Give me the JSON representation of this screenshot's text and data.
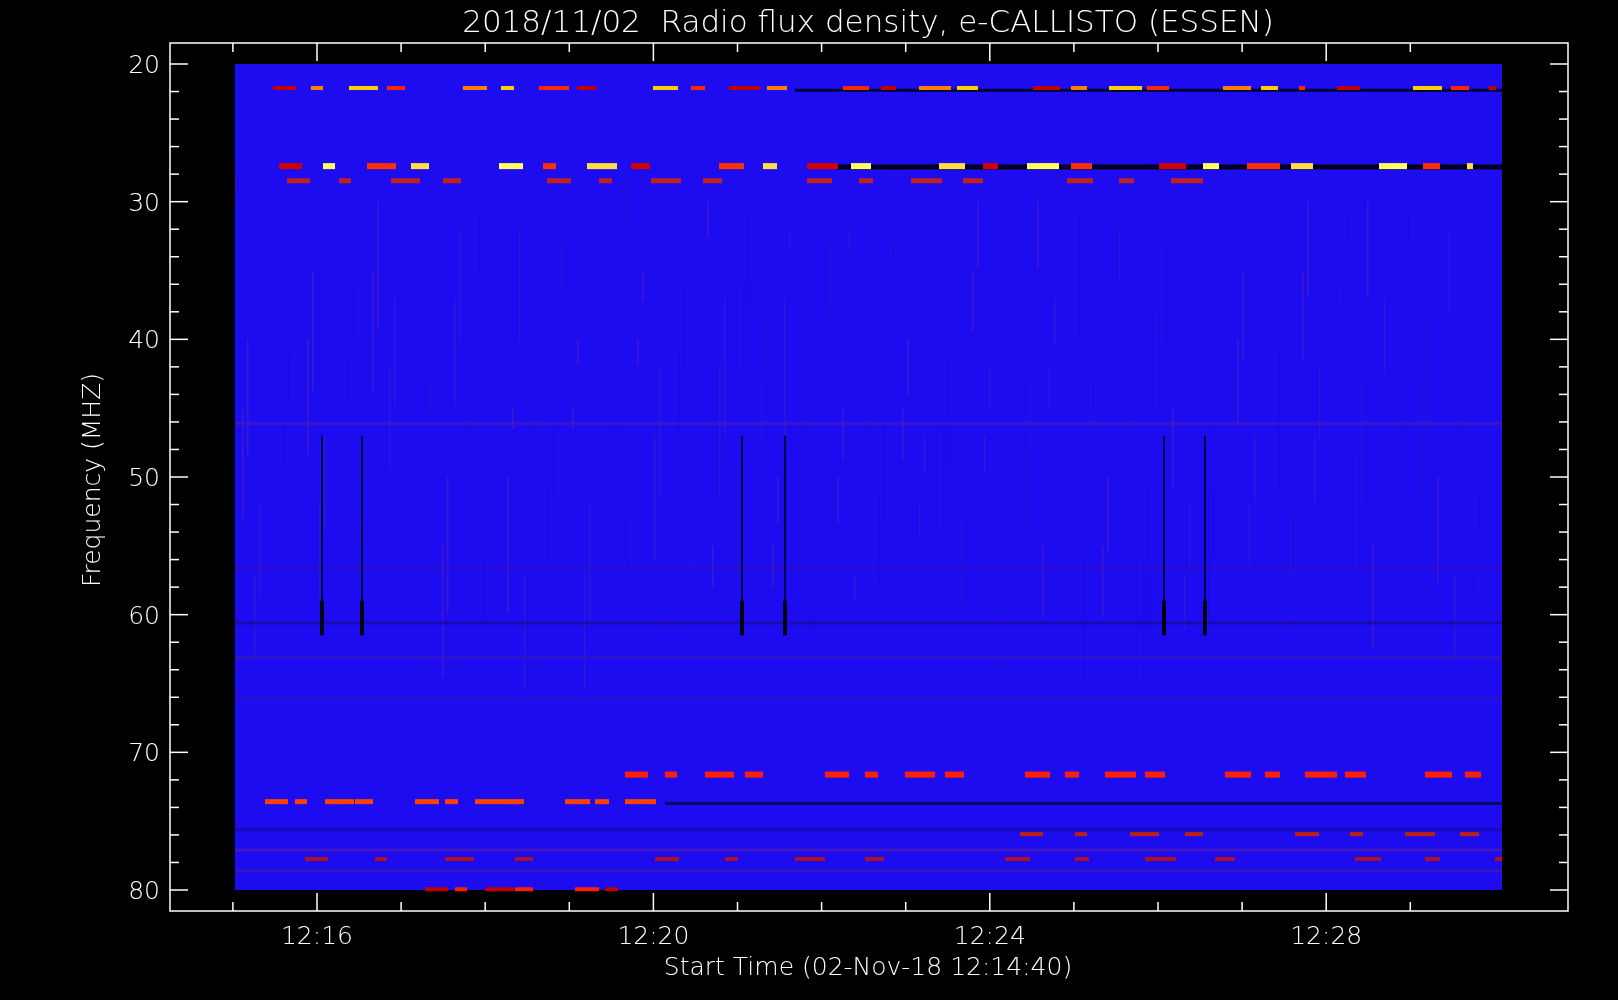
{
  "title": "2018/11/02  Radio flux density, e-CALLISTO (ESSEN)",
  "y_axis": {
    "label": "Frequency (MHZ)",
    "ticks": [
      "20",
      "30",
      "40",
      "50",
      "60",
      "70",
      "80"
    ]
  },
  "x_axis": {
    "label": "Start Time (02-Nov-18 12:14:40)",
    "ticks": [
      "12:16",
      "12:20",
      "12:24",
      "12:28"
    ]
  }
}
